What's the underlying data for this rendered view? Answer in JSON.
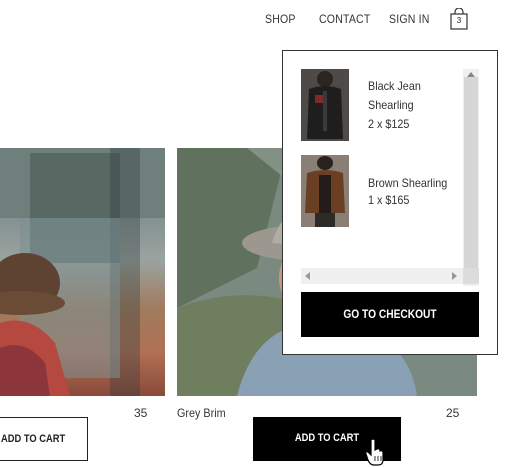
{
  "nav": {
    "shop": "SHOP",
    "contact": "CONTACT",
    "sign_in": "SIGN IN",
    "cart_count": "3"
  },
  "products": [
    {
      "name": "",
      "price": "35",
      "button": "ADD TO CART"
    },
    {
      "name": "Grey Brim",
      "price": "25",
      "button": "ADD TO CART"
    }
  ],
  "cart": {
    "items": [
      {
        "name": "Black Jean Shearling",
        "qty": "2 x $125"
      },
      {
        "name": "Brown Shearling",
        "qty": "1 x $165"
      }
    ],
    "checkout_label": "GO TO CHECKOUT"
  },
  "icons": {
    "cart": "shopping-bag-icon",
    "cursor": "hand-pointer-icon"
  },
  "colors": {
    "button_dark": "#000000",
    "border": "#222222"
  }
}
